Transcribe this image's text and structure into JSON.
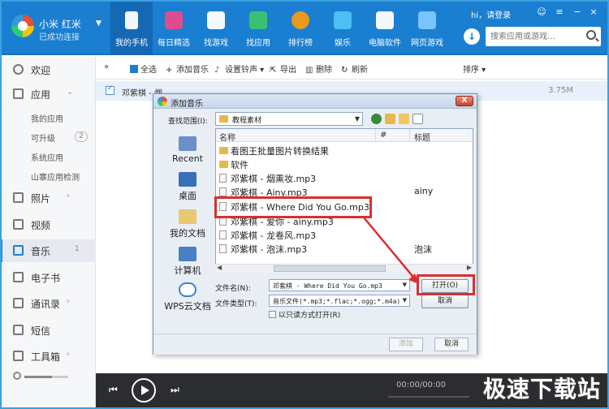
{
  "brand": {
    "name": "小米 红米",
    "status": "已成功连接"
  },
  "nav": [
    {
      "label": "我的手机",
      "icon": "phone-icon"
    },
    {
      "label": "每日精选",
      "icon": "calendar-icon"
    },
    {
      "label": "找游戏",
      "icon": "gamepad-icon"
    },
    {
      "label": "找应用",
      "icon": "app-bag-icon"
    },
    {
      "label": "排行榜",
      "icon": "ranking-medal-icon"
    },
    {
      "label": "娱乐",
      "icon": "entertainment-icon"
    },
    {
      "label": "电脑软件",
      "icon": "computer-icon"
    },
    {
      "label": "网页游戏",
      "icon": "web-game-icon"
    }
  ],
  "header": {
    "login": "hi，请登录",
    "search_placeholder": "搜索应用或游戏..."
  },
  "sidebar": {
    "items": [
      {
        "label": "欢迎",
        "icon": "welcome-icon"
      },
      {
        "label": "应用",
        "icon": "apps-icon"
      },
      {
        "label": "照片",
        "icon": "photo-icon"
      },
      {
        "label": "视频",
        "icon": "video-icon"
      },
      {
        "label": "音乐",
        "icon": "music-icon",
        "badge": "1"
      },
      {
        "label": "电子书",
        "icon": "ebook-icon"
      },
      {
        "label": "通讯录",
        "icon": "contacts-icon"
      },
      {
        "label": "短信",
        "icon": "sms-icon"
      },
      {
        "label": "工具箱",
        "icon": "toolbox-icon"
      }
    ],
    "app_sub": [
      {
        "label": "我的应用"
      },
      {
        "label": "可升级",
        "count": "2"
      },
      {
        "label": "系统应用"
      },
      {
        "label": "山寨应用检测"
      }
    ]
  },
  "toolbar": {
    "collapse": "»",
    "select_all": "全选",
    "add_music": "添加音乐",
    "set_ringtone": "设置铃声",
    "export": "导出",
    "delete": "删除",
    "refresh": "刷新",
    "sort": "排序"
  },
  "song_row": {
    "name": "邓紫棋 - 烟",
    "size": "3.75M"
  },
  "player": {
    "time": "00:00/00:00"
  },
  "dialog": {
    "title": "添加音乐",
    "close": "X",
    "look_in_label": "查找范围(I):",
    "look_in_value": "教程素材",
    "places": [
      {
        "label": "Recent",
        "icon": "recent-icon"
      },
      {
        "label": "桌面",
        "icon": "desktop-icon"
      },
      {
        "label": "我的文档",
        "icon": "my-documents-icon"
      },
      {
        "label": "计算机",
        "icon": "computer-icon"
      },
      {
        "label": "WPS云文档",
        "icon": "wps-cloud-icon"
      }
    ],
    "columns": {
      "name": "名称",
      "num": "#",
      "title": "标题"
    },
    "files": [
      {
        "name": "看图王批量图片转换结果",
        "type": "folder",
        "title": ""
      },
      {
        "name": "软件",
        "type": "folder",
        "title": ""
      },
      {
        "name": "邓紫棋 - 烟熏妆.mp3",
        "type": "file",
        "title": ""
      },
      {
        "name": "邓紫棋 - Ainy.mp3",
        "type": "file",
        "title": "ainy"
      },
      {
        "name": "邓紫棋 - Where Did You Go.mp3",
        "type": "file",
        "title": ""
      },
      {
        "name": "邓紫棋 - 爱你 - ainy.mp3",
        "type": "file",
        "title": ""
      },
      {
        "name": "邓紫棋 - 龙卷风.mp3",
        "type": "file",
        "title": ""
      },
      {
        "name": "邓紫棋 - 泡沫.mp3",
        "type": "file",
        "title": "泡沫"
      }
    ],
    "file_name_label": "文件名(N):",
    "file_name_value": "邓紫棋 - Where Did You Go.mp3",
    "file_type_label": "文件类型(T):",
    "file_type_value": "音乐文件(*.mp3;*.flac;*.ogg;*.m4a)",
    "readonly_label": "以只读方式打开(R)",
    "open_btn": "打开(O)",
    "cancel_btn": "取消",
    "footer_add": "添加",
    "footer_cancel": "取消"
  },
  "watermark": "极速下载站"
}
